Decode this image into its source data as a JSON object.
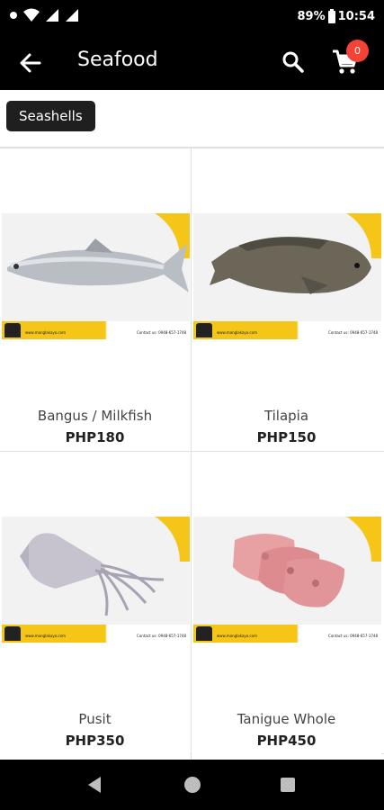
{
  "status_bar": {
    "battery": "89%",
    "time": "10:54"
  },
  "app_bar": {
    "title": "Seafood",
    "cart_count": "0"
  },
  "chips": {
    "selected": "Seashells"
  },
  "products": [
    {
      "name": "Bangus / Milkfish",
      "price": "PHP180"
    },
    {
      "name": "Tilapia",
      "price": "PHP150"
    },
    {
      "name": "Pusit",
      "price": "PHP350"
    },
    {
      "name": "Tanigue Whole",
      "price": "PHP450"
    }
  ],
  "image_banner": {
    "website": "www.manglakayo.com",
    "contact": "Contact us: 0948-657-1748"
  },
  "colors": {
    "accent_yellow": "#f5c518",
    "bar_black": "#000000",
    "badge_red": "#f44336"
  },
  "icons": [
    "back-arrow-icon",
    "search-icon",
    "cart-icon",
    "back-triangle-icon",
    "home-circle-icon",
    "recents-square-icon"
  ]
}
